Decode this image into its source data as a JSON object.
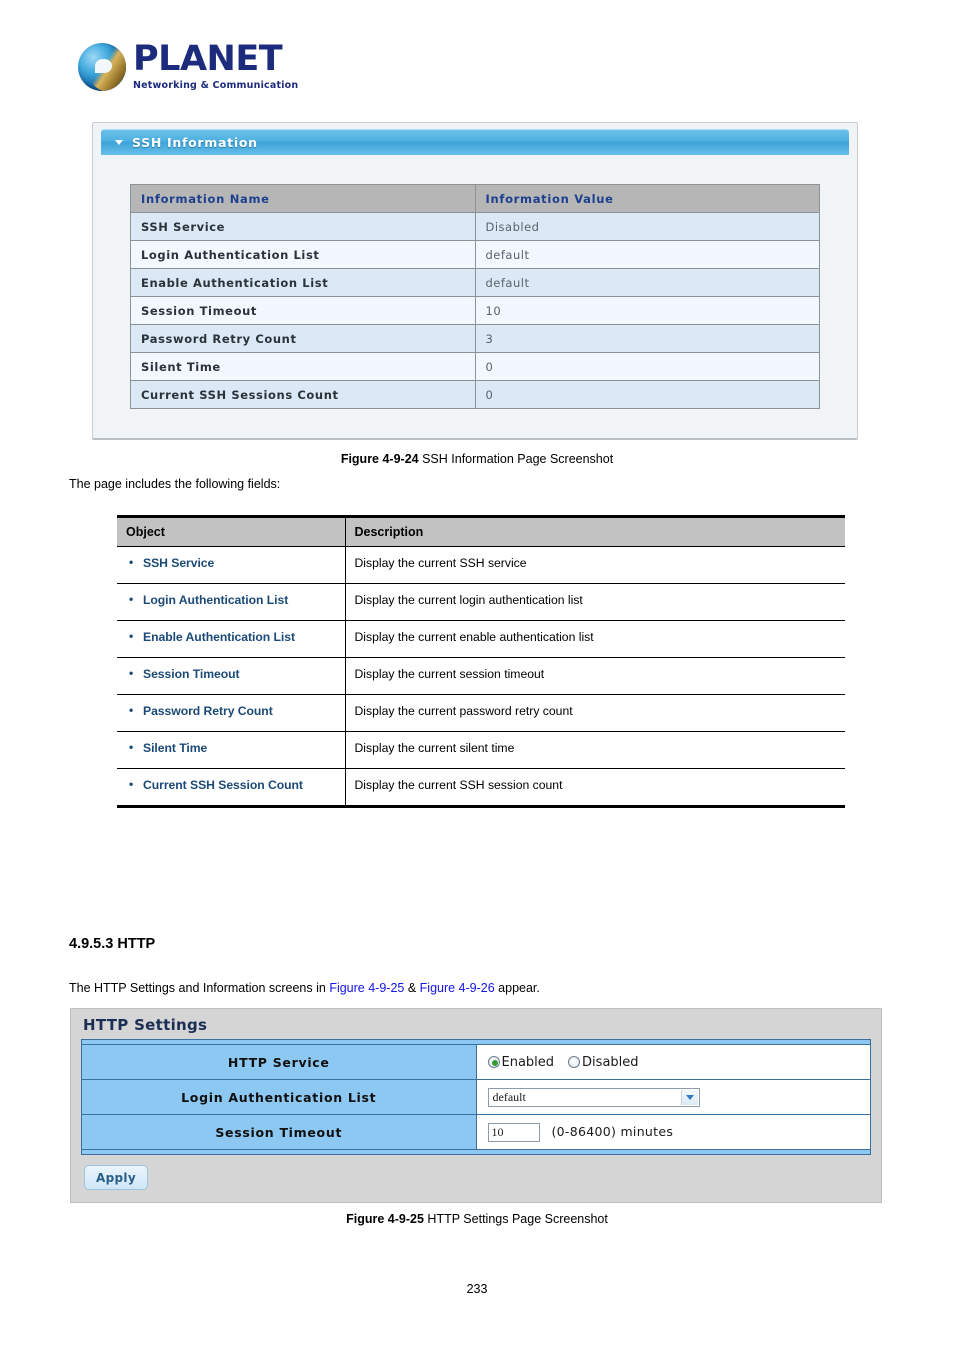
{
  "logo": {
    "name": "PLANET",
    "tagline": "Networking & Communication"
  },
  "ssh_panel": {
    "header_title": "SSH Information",
    "columns": [
      "Information Name",
      "Information Value"
    ],
    "rows": [
      {
        "name": "SSH Service",
        "value": "Disabled"
      },
      {
        "name": "Login Authentication List",
        "value": "default"
      },
      {
        "name": "Enable Authentication List",
        "value": "default"
      },
      {
        "name": "Session Timeout",
        "value": "10"
      },
      {
        "name": "Password Retry Count",
        "value": "3"
      },
      {
        "name": "Silent Time",
        "value": "0"
      },
      {
        "name": "Current SSH Sessions Count",
        "value": "0"
      }
    ]
  },
  "figure1": {
    "label": "Figure 4-9-24",
    "text": " SSH Information Page Screenshot"
  },
  "intro_text": "The page includes the following fields:",
  "object_table": {
    "columns": [
      "Object",
      "Description"
    ],
    "rows": [
      {
        "object": "SSH Service",
        "description": "Display the current SSH service"
      },
      {
        "object": "Login Authentication List",
        "description": "Display the current login authentication list"
      },
      {
        "object": "Enable Authentication List",
        "description": "Display the current enable authentication list"
      },
      {
        "object": "Session Timeout",
        "description": "Display the current session timeout"
      },
      {
        "object": "Password Retry Count",
        "description": "Display the current password retry count"
      },
      {
        "object": "Silent Time",
        "description": "Display the current silent time"
      },
      {
        "object": "Current SSH Session Count",
        "description": "Display the current SSH session count"
      }
    ]
  },
  "section": {
    "heading": "4.9.5.3 HTTP",
    "paragraph_prefix": "The HTTP Settings and Information screens in ",
    "link1": "Figure 4-9-25",
    "paragraph_mid": " & ",
    "link2": "Figure 4-9-26",
    "paragraph_suffix": " appear."
  },
  "http_panel": {
    "title": "HTTP Settings",
    "rows": {
      "service_label": "HTTP Service",
      "radio_enabled": "Enabled",
      "radio_disabled": "Disabled",
      "selected_radio": "Enabled",
      "auth_label": "Login Authentication List",
      "auth_value": "default",
      "timeout_label": "Session Timeout",
      "timeout_value": "10",
      "timeout_hint": "(0-86400) minutes"
    },
    "apply_label": "Apply"
  },
  "figure2": {
    "label": "Figure 4-9-25",
    "text": " HTTP Settings Page Screenshot"
  },
  "page_number": "233",
  "colors": {
    "panel_header_blue": "#4fb0e0",
    "table_header_gray": "#b6b6b6",
    "row_odd": "#dbe9f6",
    "row_even": "#f2f8fd",
    "label_blue": "#8dc8f2",
    "link_blue": "#1313e6",
    "object_text_blue": "#1b4a77",
    "radio_on_green": "#2f9e2f"
  }
}
